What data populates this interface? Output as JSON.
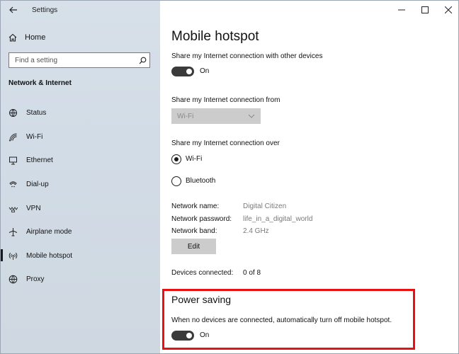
{
  "window": {
    "app_title": "Settings"
  },
  "sidebar": {
    "home_label": "Home",
    "search_placeholder": "Find a setting",
    "section_label": "Network & Internet",
    "items": [
      {
        "label": "Status",
        "icon": "globe-status-icon"
      },
      {
        "label": "Wi-Fi",
        "icon": "wifi-icon"
      },
      {
        "label": "Ethernet",
        "icon": "ethernet-icon"
      },
      {
        "label": "Dial-up",
        "icon": "dialup-icon"
      },
      {
        "label": "VPN",
        "icon": "vpn-icon"
      },
      {
        "label": "Airplane mode",
        "icon": "airplane-icon"
      },
      {
        "label": "Mobile hotspot",
        "icon": "hotspot-icon",
        "selected": true
      },
      {
        "label": "Proxy",
        "icon": "globe-icon"
      }
    ]
  },
  "main": {
    "title": "Mobile hotspot",
    "share_label": "Share my Internet connection with other devices",
    "share_toggle_state": "On",
    "share_from_label": "Share my Internet connection from",
    "share_from_value": "Wi-Fi",
    "share_over_label": "Share my Internet connection over",
    "share_over_options": [
      {
        "label": "Wi-Fi",
        "checked": true
      },
      {
        "label": "Bluetooth",
        "checked": false
      }
    ],
    "network": {
      "name_label": "Network name:",
      "name_value": "Digital Citizen",
      "password_label": "Network password:",
      "password_value": "life_in_a_digital_world",
      "band_label": "Network band:",
      "band_value": "2.4 GHz",
      "edit_label": "Edit"
    },
    "devices_label": "Devices connected:",
    "devices_value": "0 of 8",
    "power_saving": {
      "title": "Power saving",
      "description": "When no devices are connected, automatically turn off mobile hotspot.",
      "toggle_state": "On"
    }
  },
  "colors": {
    "highlight": "#e81010",
    "toggle_on": "#3a3a3a",
    "sidebar_bg": "#d2dce6"
  }
}
